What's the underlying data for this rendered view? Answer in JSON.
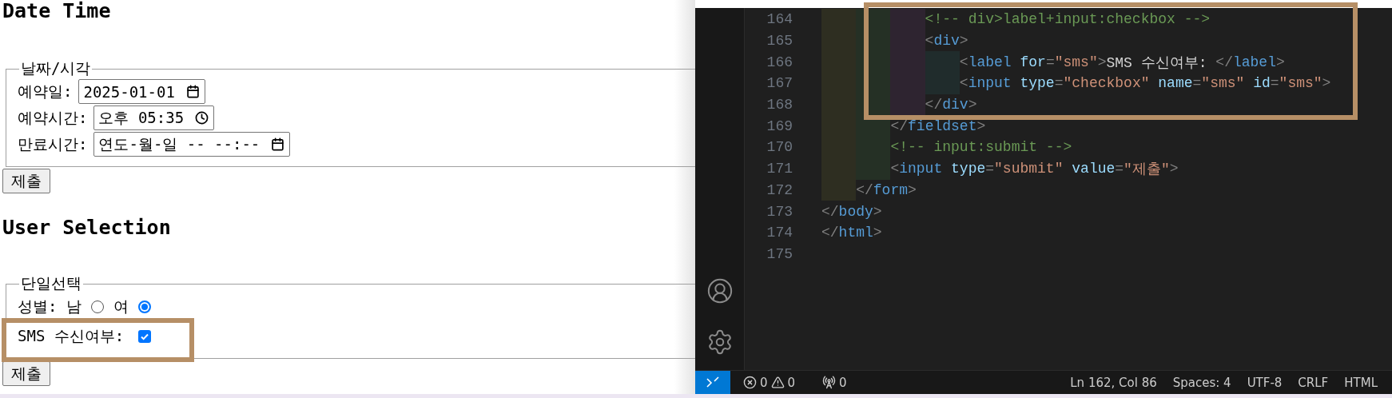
{
  "browser_page": {
    "date_section": {
      "heading": "Date Time",
      "legend": "날짜/시각",
      "fields": [
        {
          "label": "예약일:",
          "value": "2025-01-01",
          "kind": "date"
        },
        {
          "label": "예약시간:",
          "value": "오후 05:35",
          "kind": "time"
        },
        {
          "label": "만료시간:",
          "value": "연도-월-일 -- --:--",
          "kind": "datetime"
        }
      ],
      "submit": "제출"
    },
    "selection_section": {
      "heading": "User Selection",
      "legend": "단일선택",
      "radio_group": {
        "label": "성별:",
        "options": [
          {
            "label": "남",
            "selected": false
          },
          {
            "label": "여",
            "selected": true
          }
        ]
      },
      "checkbox": {
        "label": "SMS 수신여부:",
        "checked": true
      },
      "submit": "제출"
    }
  },
  "editor": {
    "lines": [
      {
        "number": "164",
        "tokens": [
          {
            "kind": "comment",
            "text": "            <!-- div>label+input:checkbox -->"
          }
        ]
      },
      {
        "number": "165",
        "tokens": [
          {
            "kind": "punct",
            "text": "            <"
          },
          {
            "kind": "tag",
            "text": "div"
          },
          {
            "kind": "punct",
            "text": ">"
          }
        ]
      },
      {
        "number": "166",
        "tokens": [
          {
            "kind": "punct",
            "text": "                <"
          },
          {
            "kind": "tag",
            "text": "label"
          },
          {
            "kind": "attr",
            "text": " for"
          },
          {
            "kind": "punct",
            "text": "="
          },
          {
            "kind": "string",
            "text": "\"sms\""
          },
          {
            "kind": "punct",
            "text": ">"
          },
          {
            "kind": "text",
            "text": "SMS 수신여부: "
          },
          {
            "kind": "punct",
            "text": "</"
          },
          {
            "kind": "tag",
            "text": "label"
          },
          {
            "kind": "punct",
            "text": ">"
          }
        ]
      },
      {
        "number": "167",
        "tokens": [
          {
            "kind": "punct",
            "text": "                <"
          },
          {
            "kind": "tag",
            "text": "input"
          },
          {
            "kind": "attr",
            "text": " type"
          },
          {
            "kind": "punct",
            "text": "="
          },
          {
            "kind": "string",
            "text": "\"checkbox\""
          },
          {
            "kind": "attr",
            "text": " name"
          },
          {
            "kind": "punct",
            "text": "="
          },
          {
            "kind": "string",
            "text": "\"sms\""
          },
          {
            "kind": "attr",
            "text": " id"
          },
          {
            "kind": "punct",
            "text": "="
          },
          {
            "kind": "string",
            "text": "\"sms\""
          },
          {
            "kind": "punct",
            "text": ">"
          }
        ]
      },
      {
        "number": "168",
        "tokens": [
          {
            "kind": "punct",
            "text": "            </"
          },
          {
            "kind": "tag",
            "text": "div"
          },
          {
            "kind": "punct",
            "text": ">"
          }
        ]
      },
      {
        "number": "169",
        "tokens": [
          {
            "kind": "punct",
            "text": "        </"
          },
          {
            "kind": "tag",
            "text": "fieldset"
          },
          {
            "kind": "punct",
            "text": ">"
          }
        ]
      },
      {
        "number": "170",
        "tokens": [
          {
            "kind": "comment",
            "text": "        <!-- input:submit -->"
          }
        ]
      },
      {
        "number": "171",
        "tokens": [
          {
            "kind": "punct",
            "text": "        <"
          },
          {
            "kind": "tag",
            "text": "input"
          },
          {
            "kind": "attr",
            "text": " type"
          },
          {
            "kind": "punct",
            "text": "="
          },
          {
            "kind": "string",
            "text": "\"submit\""
          },
          {
            "kind": "attr",
            "text": " value"
          },
          {
            "kind": "punct",
            "text": "="
          },
          {
            "kind": "string",
            "text": "\"제출\""
          },
          {
            "kind": "punct",
            "text": ">"
          }
        ]
      },
      {
        "number": "172",
        "tokens": [
          {
            "kind": "punct",
            "text": "    </"
          },
          {
            "kind": "tag",
            "text": "form"
          },
          {
            "kind": "punct",
            "text": ">"
          }
        ]
      },
      {
        "number": "173",
        "tokens": [
          {
            "kind": "punct",
            "text": "</"
          },
          {
            "kind": "tag",
            "text": "body"
          },
          {
            "kind": "punct",
            "text": ">"
          }
        ]
      },
      {
        "number": "174",
        "tokens": [
          {
            "kind": "punct",
            "text": "</"
          },
          {
            "kind": "tag",
            "text": "html"
          },
          {
            "kind": "punct",
            "text": ">"
          }
        ]
      },
      {
        "number": "175"
      }
    ]
  },
  "status_bar": {
    "errors": "0",
    "warnings": "0",
    "ports": "0",
    "items": [
      "Ln 162, Col 86",
      "Spaces: 4",
      "UTF-8",
      "CRLF",
      "HTML"
    ]
  }
}
